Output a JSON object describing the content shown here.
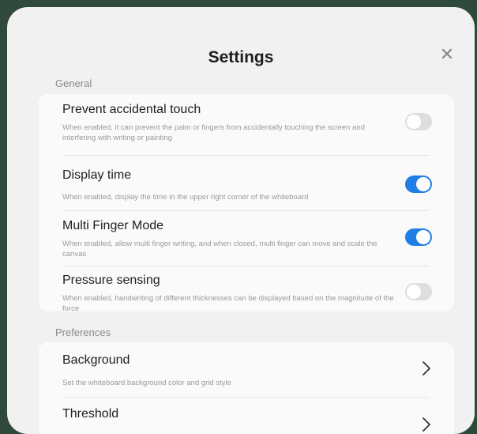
{
  "dialog": {
    "title": "Settings"
  },
  "sections": {
    "general": {
      "label": "General",
      "items": [
        {
          "title": "Prevent accidental touch",
          "desc": "When enabled, it can prevent the palm or fingers from accidentally touching the screen and interfering with writing or painting",
          "toggle": false
        },
        {
          "title": "Display time",
          "desc": "When enabled, display the time in the upper right corner of the whiteboard",
          "toggle": true
        },
        {
          "title": "Multi Finger Mode",
          "desc": "When enabled, allow multi finger writing, and when closed, multi finger can move and scale the canvas",
          "toggle": true
        },
        {
          "title": "Pressure sensing",
          "desc": "When enabled, handwriting of different thicknesses can be displayed based on the magnitude of the force",
          "toggle": false
        }
      ]
    },
    "preferences": {
      "label": "Preferences",
      "items": [
        {
          "title": "Background",
          "desc": "Set the whiteboard background color and grid style"
        },
        {
          "title": "Threshold",
          "desc": ""
        }
      ]
    }
  },
  "icons": {
    "close": "close-icon",
    "chevron": "chevron-right-icon"
  },
  "colors": {
    "accent": "#1f7de6",
    "toggle_off": "#dedede",
    "background": "#2f4a3d"
  }
}
